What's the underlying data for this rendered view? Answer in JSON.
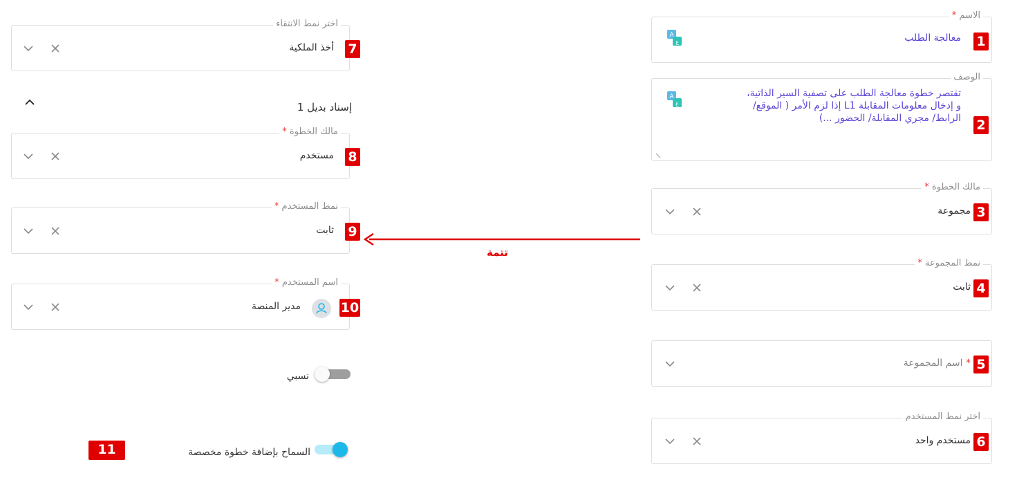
{
  "right_column": {
    "name": {
      "label": "الاسم",
      "required": "*",
      "value": "معالجة الطلب",
      "badge": "1"
    },
    "description": {
      "label": "الوصف",
      "line1": "تقتصر خطوة معالجة الطلب على تصفية السير الذاتية،",
      "line2": "و إدخال معلومات المقابلة L1 إذا لزم الأمر ( الموقع/",
      "line3": "الرابط/ مجري المقابلة/ الحضور ...)",
      "badge": "2"
    },
    "step_owner": {
      "label": "مالك الخطوة",
      "required": "*",
      "value": "مجموعة",
      "badge": "3"
    },
    "group_pattern": {
      "label": "نمط المجموعة",
      "required": "*",
      "value": "ثابت",
      "badge": "4"
    },
    "group_name": {
      "placeholder": "اسم المجموعة",
      "required": "*",
      "badge": "5"
    },
    "user_pattern": {
      "label": "اختر نمط المستخدم",
      "value": "مستخدم واحد",
      "badge": "6"
    }
  },
  "left_column": {
    "selection_pattern": {
      "label": "اختر نمط الانتقاء",
      "value": "أخذ الملكية",
      "badge": "7"
    },
    "alt_assignment": {
      "title": "إسناد بديل 1"
    },
    "step_owner": {
      "label": "مالك الخطوة",
      "required": "*",
      "value": "مستخدم",
      "badge": "8"
    },
    "user_pattern": {
      "label": "نمط المستخدم",
      "required": "*",
      "value": "ثابت",
      "badge": "9"
    },
    "user_name": {
      "label": "اسم المستخدم",
      "required": "*",
      "value": "مدير المنصة",
      "badge": "10"
    },
    "relative_toggle": {
      "label": "نسبي",
      "on": false
    },
    "custom_step_toggle": {
      "label": "السماح بإضافة خطوة مخصصة",
      "on": true,
      "badge": "11"
    }
  },
  "annotation": {
    "arrow_label": "تتمة"
  },
  "colors": {
    "badge": "#e00000",
    "link_text": "#5a46d6",
    "toggle_on": "#1db8ea",
    "toggle_on_track": "#b6ebf8",
    "toggle_off_track": "#9e9e9e"
  }
}
